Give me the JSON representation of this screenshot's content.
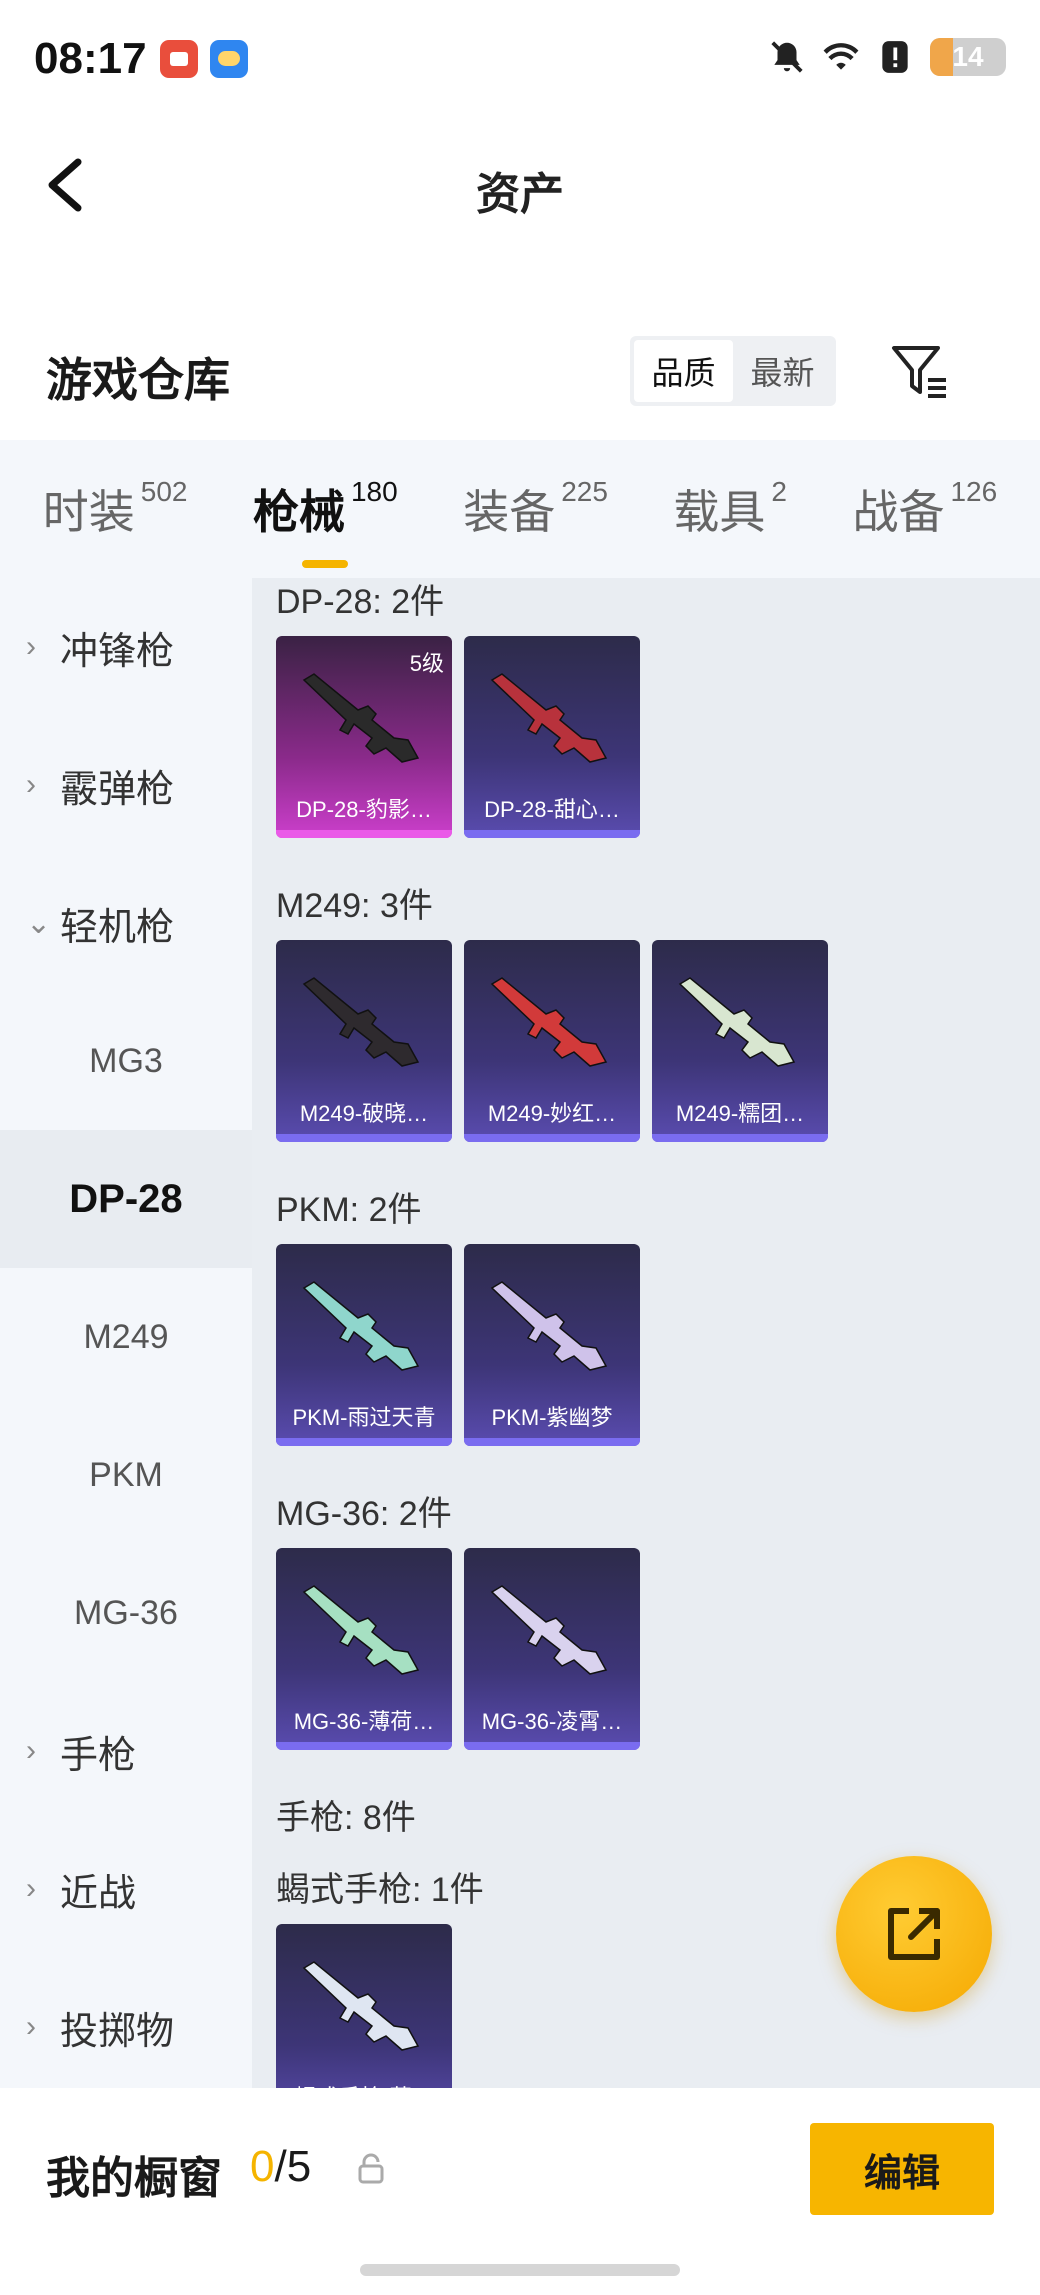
{
  "status_bar": {
    "time": "08:17",
    "battery": "14"
  },
  "header": {
    "title": "资产"
  },
  "warehouse": {
    "title": "游戏仓库",
    "sort_options": [
      "品质",
      "最新"
    ],
    "active_sort": "品质"
  },
  "tabs": [
    {
      "label": "时装",
      "count": "502"
    },
    {
      "label": "枪械",
      "count": "180",
      "active": true
    },
    {
      "label": "装备",
      "count": "225"
    },
    {
      "label": "载具",
      "count": "2"
    },
    {
      "label": "战备",
      "count": "126"
    }
  ],
  "sidebar": [
    {
      "label": "冲锋枪",
      "type": "category"
    },
    {
      "label": "霰弹枪",
      "type": "category"
    },
    {
      "label": "轻机枪",
      "type": "category",
      "expanded": true
    },
    {
      "label": "MG3",
      "type": "sub"
    },
    {
      "label": "DP-28",
      "type": "sub",
      "active": true
    },
    {
      "label": "M249",
      "type": "sub"
    },
    {
      "label": "PKM",
      "type": "sub"
    },
    {
      "label": "MG-36",
      "type": "sub"
    },
    {
      "label": "手枪",
      "type": "category"
    },
    {
      "label": "近战",
      "type": "category"
    },
    {
      "label": "投掷物",
      "type": "category"
    }
  ],
  "groups": [
    {
      "title": "DP-28: 2件",
      "items": [
        {
          "name": "DP-28-豹影…",
          "level": "5级",
          "rarity": "pink",
          "gun_color": "#2a2a2a"
        },
        {
          "name": "DP-28-甜心…",
          "rarity": "purple",
          "gun_color": "#b8323c"
        }
      ]
    },
    {
      "title": "M249: 3件",
      "items": [
        {
          "name": "M249-破晓…",
          "rarity": "purple",
          "gun_color": "#2e2a2e"
        },
        {
          "name": "M249-妙红…",
          "rarity": "purple",
          "gun_color": "#d23a3a"
        },
        {
          "name": "M249-糯团…",
          "rarity": "purple",
          "gun_color": "#d8e6d0"
        }
      ]
    },
    {
      "title": "PKM: 2件",
      "items": [
        {
          "name": "PKM-雨过天青",
          "rarity": "purple",
          "gun_color": "#8fd6cc"
        },
        {
          "name": "PKM-紫幽梦",
          "rarity": "purple",
          "gun_color": "#cfc2ea"
        }
      ]
    },
    {
      "title": "MG-36: 2件",
      "items": [
        {
          "name": "MG-36-薄荷…",
          "rarity": "purple",
          "gun_color": "#a6e0c2"
        },
        {
          "name": "MG-36-凌霄…",
          "rarity": "purple",
          "gun_color": "#d9d2ee"
        }
      ]
    },
    {
      "title": "手枪: 8件",
      "items": []
    },
    {
      "title": "蝎式手枪: 1件",
      "items": [
        {
          "name": "蝎式手枪-蓝…",
          "rarity": "purple",
          "gun_color": "#dfe6f2"
        }
      ]
    }
  ],
  "showcase": {
    "label": "我的橱窗",
    "current": "0",
    "total": "/5"
  },
  "edit_button": "编辑",
  "colors": {
    "accent": "#f5b400",
    "rarity_pink": "#cc3fcc",
    "rarity_purple": "#5a4cb0"
  }
}
